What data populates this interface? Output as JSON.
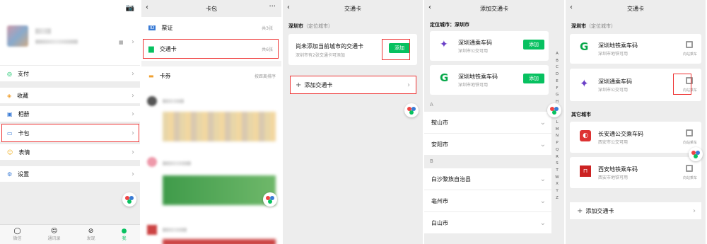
{
  "p1": {
    "menu": [
      {
        "label": "支付"
      },
      {
        "label": "收藏"
      },
      {
        "label": "相册"
      },
      {
        "label": "卡包"
      },
      {
        "label": "表情"
      },
      {
        "label": "设置"
      }
    ],
    "tabs": [
      "微信",
      "通讯录",
      "发现",
      "我"
    ]
  },
  "p2": {
    "title": "卡包",
    "rows": [
      {
        "label": "票证",
        "count": "共3张"
      },
      {
        "label": "交通卡",
        "count": "共6张"
      }
    ],
    "coupon_label": "卡券",
    "sort_label": "按距离排序"
  },
  "p3": {
    "title": "交通卡",
    "city": "深圳市",
    "city_note": "（定位城市）",
    "empty_title": "尚未添加当前城市的交通卡",
    "empty_sub": "深圳市有2张交通卡可添加",
    "add_btn": "添加",
    "add_card": "添加交通卡"
  },
  "p4": {
    "title": "添加交通卡",
    "located": "定位城市：深圳市",
    "cards": [
      {
        "name": "深圳通乘车码",
        "sub": "深圳市公交可用",
        "btn": "添加"
      },
      {
        "name": "深圳地铁乘车码",
        "sub": "深圳市地铁可用",
        "btn": "添加"
      }
    ],
    "groups": [
      {
        "letter": "A",
        "cities": [
          "鞍山市",
          "安阳市"
        ]
      },
      {
        "letter": "B",
        "cities": [
          "白沙黎族自治县",
          "亳州市",
          "白山市"
        ]
      }
    ],
    "index": [
      "A",
      "B",
      "C",
      "D",
      "E",
      "F",
      "G",
      "H",
      "J",
      "K",
      "L",
      "M",
      "N",
      "P",
      "Q",
      "R",
      "S",
      "T",
      "W",
      "X",
      "Y",
      "Z"
    ]
  },
  "p5": {
    "title": "交通卡",
    "city": "深圳市",
    "city_note": "（定位城市）",
    "local_cards": [
      {
        "name": "深圳地铁乘车码",
        "sub": "深圳市地铁可用",
        "qr": "向站乘车"
      },
      {
        "name": "深圳通乘车码",
        "sub": "深圳市公交可用",
        "qr": "向站乘车"
      }
    ],
    "other_label": "其它城市",
    "other_cards": [
      {
        "name": "长安通公交乘车码",
        "sub": "西安市公交可用",
        "qr": "向站乘车"
      },
      {
        "name": "西安地铁乘车码",
        "sub": "西安市地铁可用",
        "qr": "向站乘车"
      }
    ],
    "add_card": "添加交通卡"
  },
  "colors": {
    "accent_green": "#07c160",
    "highlight_red": "#e33333"
  }
}
